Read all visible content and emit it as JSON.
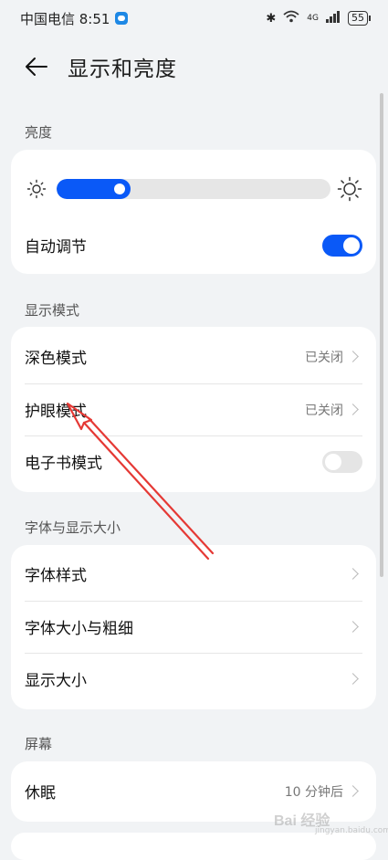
{
  "status_bar": {
    "carrier_time": "中国电信 8:51",
    "network": "4G",
    "battery": "55"
  },
  "header": {
    "title": "显示和亮度"
  },
  "brightness": {
    "section_label": "亮度",
    "level_percent": 27,
    "auto_adjust_label": "自动调节",
    "auto_adjust_on": true
  },
  "display_mode": {
    "section_label": "显示模式",
    "dark_mode_label": "深色模式",
    "dark_mode_value": "已关闭",
    "eye_comfort_label": "护眼模式",
    "eye_comfort_value": "已关闭",
    "ebook_mode_label": "电子书模式",
    "ebook_mode_on": false
  },
  "font_display": {
    "section_label": "字体与显示大小",
    "font_style_label": "字体样式",
    "font_size_weight_label": "字体大小与粗细",
    "display_size_label": "显示大小"
  },
  "screen": {
    "section_label": "屏幕",
    "sleep_label": "休眠",
    "sleep_value": "10 分钟后"
  },
  "watermark": {
    "text": "Bai 经验",
    "sub": "jingyan.baidu.com"
  },
  "colors": {
    "accent": "#0a59f7",
    "annotation_arrow": "#e53935"
  }
}
